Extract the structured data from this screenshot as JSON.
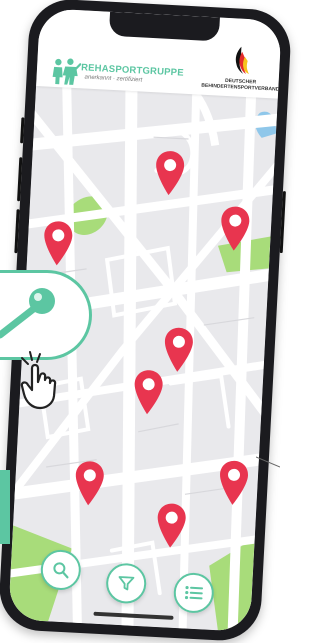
{
  "header": {
    "brand_title": "REHASPORTGRUPPE",
    "brand_subtitle": "anerkannt · zertifiziert",
    "partner_name": "DEUTSCHER BEHINDERTENSPORTVERBAND"
  },
  "map": {
    "pins": [
      "location-pin",
      "location-pin",
      "location-pin",
      "location-pin",
      "location-pin",
      "location-pin",
      "location-pin",
      "location-pin"
    ]
  },
  "actions": {
    "search_icon": "search-icon",
    "filter_icon": "filter-icon",
    "list_icon": "list-icon"
  },
  "colors": {
    "accent": "#5cc6a2",
    "pin": "#e8354f",
    "map_background": "#e9e9ec",
    "park": "#a8dc7a",
    "water": "#8fc7ea"
  }
}
